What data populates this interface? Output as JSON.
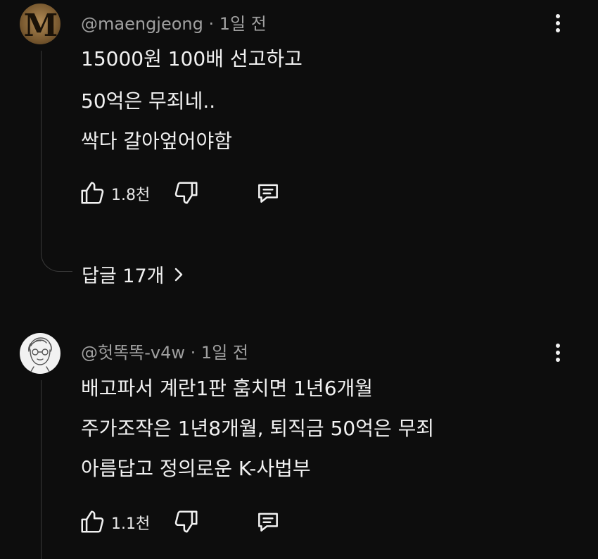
{
  "comments": [
    {
      "author": "@maengjeong",
      "time": "1일 전",
      "avatar_icon": "letter-m-avatar",
      "avatar_letter": "M",
      "lines": [
        "15000원 100배 선고하고",
        "50억은 무죄네..",
        "싹다 갈아엎어야함"
      ],
      "likes": "1.8천",
      "replies_label": "답글 17개"
    },
    {
      "author": "@헛똑똑-v4w",
      "time": "1일 전",
      "avatar_icon": "drawn-face-avatar",
      "lines": [
        "배고파서 계란1판 훔치면  1년6개월",
        "주가조작은  1년8개월,  퇴직금 50억은 무죄",
        "아름답고  정의로운  K-사법부"
      ],
      "likes": "1.1천"
    }
  ],
  "colors": {
    "background": "#0d0d0d",
    "text": "#f1f1f1",
    "meta": "#a0a0a0",
    "thread": "#3a3a3a"
  },
  "icons": [
    "thumbs-up-icon",
    "thumbs-down-icon",
    "reply-comment-icon",
    "more-vert-icon",
    "chevron-right-icon"
  ]
}
